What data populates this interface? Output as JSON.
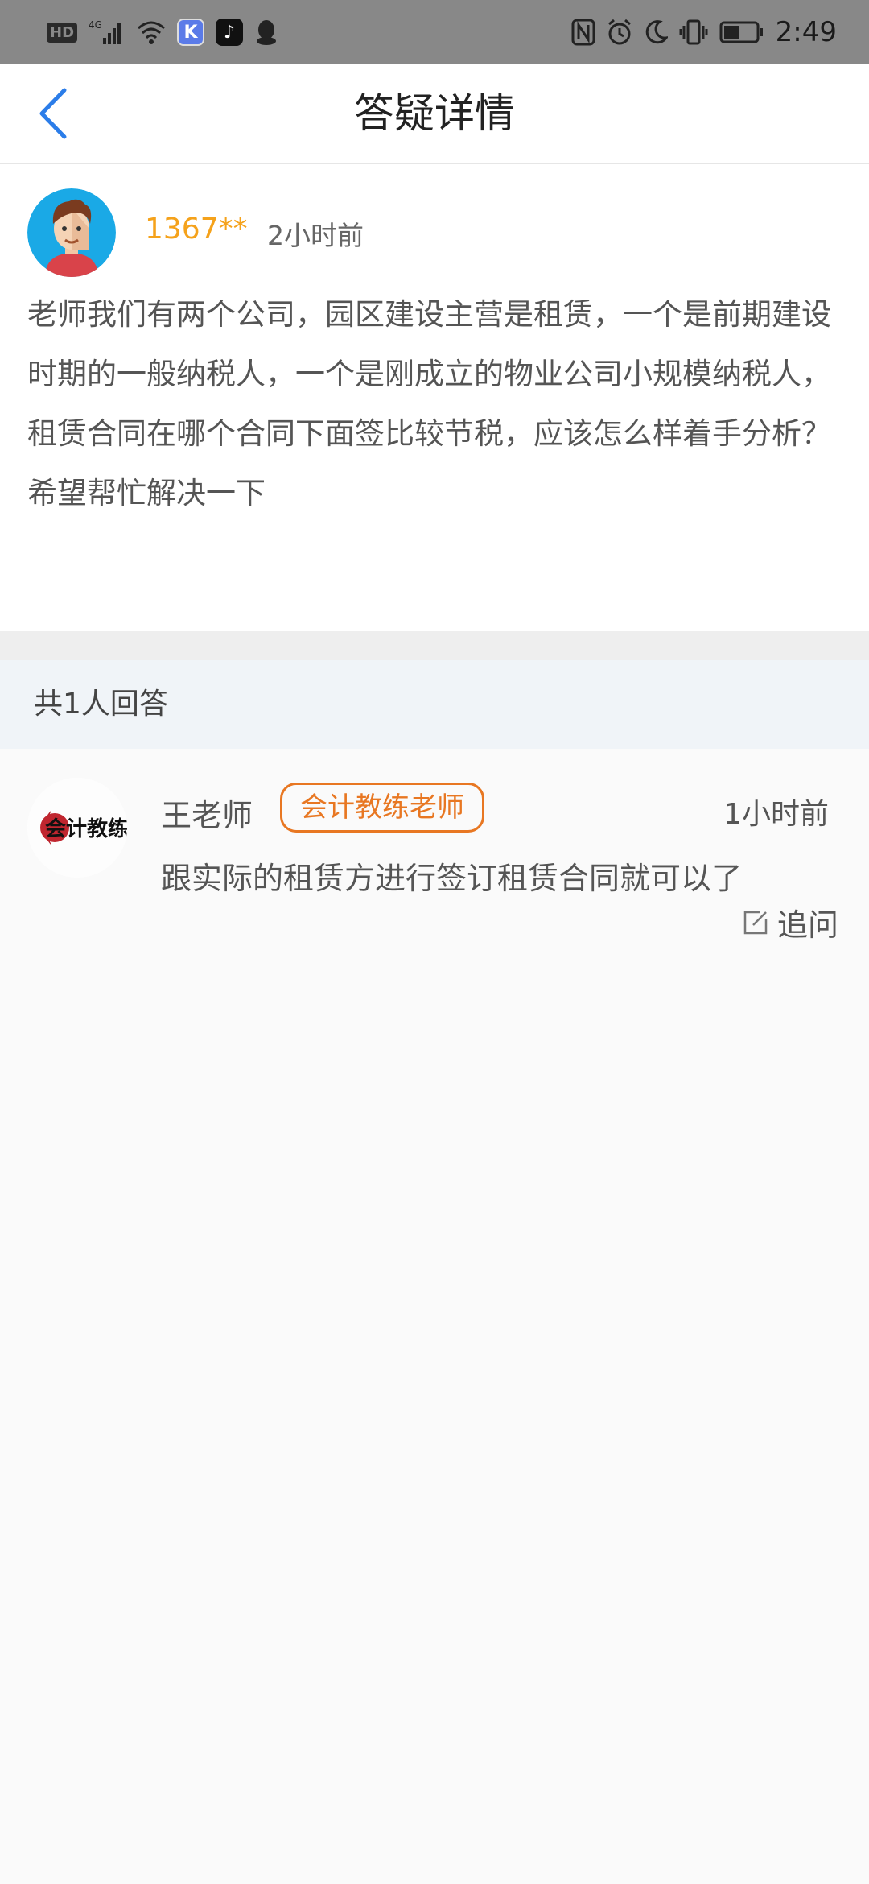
{
  "status_bar": {
    "left_icons": [
      "hd-badge",
      "4g-signal-icon",
      "wifi-icon",
      "k-app-icon",
      "tiktok-icon",
      "qq-icon"
    ],
    "hd_label": "HD",
    "right_icons": [
      "nfc-icon",
      "alarm-icon",
      "moon-icon",
      "vibrate-icon",
      "battery-icon"
    ],
    "time": "2:49",
    "battery_level": 0.5
  },
  "header": {
    "title": "答疑详情",
    "back_icon": "chevron-left-icon",
    "accent_color": "#2b7de9"
  },
  "question": {
    "user": "1367**",
    "time": "2小时前",
    "text": "老师我们有两个公司，园区建设主营是租赁，一个是前期建设时期的一般纳税人，一个是刚成立的物业公司小规模纳税人，租赁合同在哪个合同下面签比较节税，应该怎么样着手分析？希望帮忙解决一下"
  },
  "answers": {
    "count_label": "共1人回答",
    "items": [
      {
        "name": "王老师",
        "badge": "会计教练老师",
        "time": "1小时前",
        "text": "跟实际的租赁方进行签订租赁合同就可以了",
        "followup_label": "追问",
        "logo_text": "会计教练"
      }
    ]
  }
}
